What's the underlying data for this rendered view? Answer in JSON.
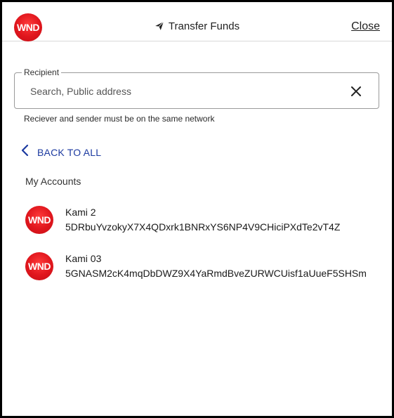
{
  "header": {
    "logo_text": "WND",
    "title": "Transfer Funds",
    "title_icon": "paper-plane-icon",
    "close_label": "Close"
  },
  "recipient": {
    "label": "Recipient",
    "placeholder": "Search, Public address",
    "value": "",
    "clear_icon": "close-icon",
    "helper": "Reciever and sender must be on the same network"
  },
  "back": {
    "icon": "chevron-left-icon",
    "label": "BACK TO ALL"
  },
  "my_accounts": {
    "title": "My Accounts",
    "items": [
      {
        "avatar_text": "WND",
        "name": "Kami 2",
        "address": "5DRbuYvzokyX7X4QDxrk1BNRxYS6NP4V9CHiciPXdTe2vT4Z"
      },
      {
        "avatar_text": "WND",
        "name": "Kami 03",
        "address": "5GNASM2cK4mqDbDWZ9X4YaRmdBveZURWCUisf1aUueF5SHSm"
      }
    ]
  },
  "colors": {
    "brand_red": "#e0161d",
    "link_blue": "#1c3aa0"
  }
}
